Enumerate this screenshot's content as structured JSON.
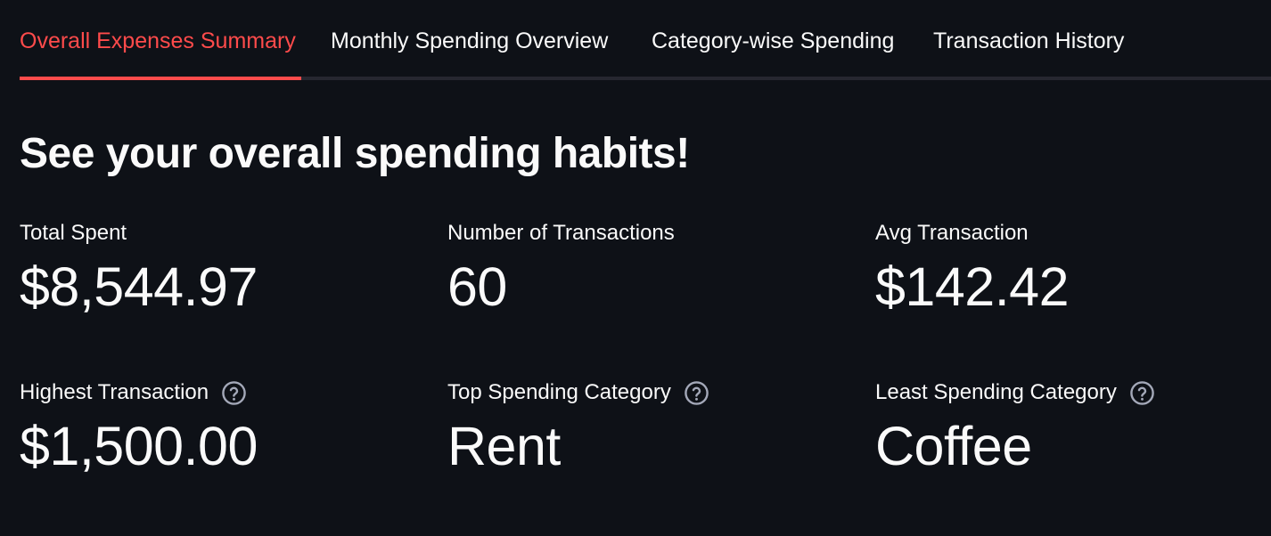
{
  "tabs": [
    {
      "label": "Overall Expenses Summary",
      "active": true
    },
    {
      "label": "Monthly Spending Overview",
      "active": false
    },
    {
      "label": "Category-wise Spending",
      "active": false
    },
    {
      "label": "Transaction History",
      "active": false
    }
  ],
  "page_title": "See your overall spending habits!",
  "metrics": [
    {
      "label": "Total Spent",
      "value": "$8,544.97",
      "help": false
    },
    {
      "label": "Number of Transactions",
      "value": "60",
      "help": false
    },
    {
      "label": "Avg Transaction",
      "value": "$142.42",
      "help": false
    },
    {
      "label": "Highest Transaction",
      "value": "$1,500.00",
      "help": true
    },
    {
      "label": "Top Spending Category",
      "value": "Rent",
      "help": true
    },
    {
      "label": "Least Spending Category",
      "value": "Coffee",
      "help": true
    }
  ],
  "colors": {
    "background": "#0e1117",
    "text": "#fafafa",
    "accent": "#ff4b4b",
    "tab_track": "#262730",
    "help_icon": "#a3a8b8"
  },
  "icons": {
    "help": "question-circle-icon"
  }
}
